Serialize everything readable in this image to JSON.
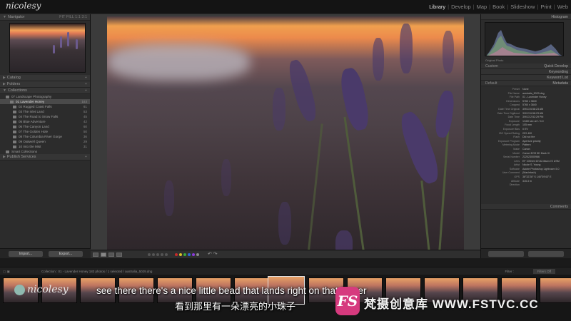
{
  "app": {
    "logo": "nicolesy",
    "modules": [
      "Library",
      "Develop",
      "Map",
      "Book",
      "Slideshow",
      "Print",
      "Web"
    ],
    "active_module": "Library"
  },
  "left_panel": {
    "navigator": {
      "label": "Navigator",
      "zoom_options": "FIT FILL 1:1 3:1"
    },
    "sections": [
      {
        "label": "Catalog"
      },
      {
        "label": "Folders"
      },
      {
        "label": "Collections"
      }
    ],
    "collections": [
      {
        "label": "07 Landscape Photography",
        "count": "",
        "level": 1
      },
      {
        "label": "01 Lavender Honey",
        "count": "183",
        "level": 2,
        "selected": true
      },
      {
        "label": "02 Rugged Coast Falls",
        "count": "61",
        "level": 2
      },
      {
        "label": "03 The Inlet Land",
        "count": "53",
        "level": 2
      },
      {
        "label": "04 The Road to Snow Falls",
        "count": "45",
        "level": 2
      },
      {
        "label": "05 Blue Adventure",
        "count": "42",
        "level": 2
      },
      {
        "label": "06 The Canyon Land",
        "count": "60",
        "level": 2
      },
      {
        "label": "07 The Golden Hole",
        "count": "50",
        "level": 2
      },
      {
        "label": "08 The Columbia River Gorge",
        "count": "36",
        "level": 2
      },
      {
        "label": "09 Oakwell Queen",
        "count": "29",
        "level": 2
      },
      {
        "label": "10 Into the Mist",
        "count": "31",
        "level": 2
      },
      {
        "label": "Smart Collections",
        "count": "",
        "level": 1
      }
    ],
    "publish_services": "Publish Services",
    "import_button": "Import...",
    "export_button": "Export..."
  },
  "right_panel": {
    "histogram": "Histogram",
    "original_photo": "Original Photo",
    "quick_develop": "Quick Develop",
    "quick_develop_preset": "Custom",
    "keywording": "Keywording",
    "keyword_list": "Keyword List",
    "metadata": "Metadata",
    "preset_label": "Preset",
    "preset_value": "None",
    "default_label": "Default",
    "metadata_rows": [
      {
        "key": "File Name",
        "value": "australia_5029.dng"
      },
      {
        "key": "File Path",
        "value": "01 - Lavender Honey"
      },
      {
        "key": "Dimensions",
        "value": "5760 x 3840"
      },
      {
        "key": "Cropped",
        "value": "5760 x 3840"
      },
      {
        "key": "Date Time Original",
        "value": "3/9/13 6:58:23 AM"
      },
      {
        "key": "Date Time Digitized",
        "value": "3/9/13 6:58:23 AM"
      },
      {
        "key": "Date Time",
        "value": "3/9/13 2:52:29 PM"
      },
      {
        "key": "Exposure",
        "value": "1/160 sec at f / 4.0"
      },
      {
        "key": "Focal Length",
        "value": "105 mm"
      },
      {
        "key": "Exposure Bias",
        "value": "0 EV"
      },
      {
        "key": "ISO Speed Rating",
        "value": "ISO 400"
      },
      {
        "key": "Flash",
        "value": "Did not fire"
      },
      {
        "key": "Exposure Program",
        "value": "Aperture priority"
      },
      {
        "key": "Metering Mode",
        "value": "Pattern"
      },
      {
        "key": "Make",
        "value": "Canon"
      },
      {
        "key": "Model",
        "value": "Canon EOS 5D Mark III"
      },
      {
        "key": "Serial Number",
        "value": "222023000966"
      },
      {
        "key": "Lens",
        "value": "EF 100mm f/2.8L Macro IS USM"
      },
      {
        "key": "Artist",
        "value": "Nicole S. Young"
      },
      {
        "key": "Software",
        "value": "Adobe Photoshop Lightroom 5.0 (Macintosh)"
      },
      {
        "key": "User Comment",
        "value": ""
      },
      {
        "key": "GPS",
        "value": "38°32'28\" S 145°39'43\" E"
      },
      {
        "key": "Altitude",
        "value": "315.3 m"
      },
      {
        "key": "Direction",
        "value": ""
      }
    ],
    "comments": "Comments"
  },
  "toolbar": {
    "sort_label": "",
    "swatch_colors": [
      "#c62a2a",
      "#d8c32a",
      "#3aa83a",
      "#2a6ad8",
      "#8a3ad8",
      "#8a8a8a"
    ]
  },
  "filmstrip_bar": {
    "path": "Collection : 01 - Lavender Honey     183 photos / 1 selected / australia_5029.dng",
    "filter_label": "Filter :",
    "filter_value": "Filters Off"
  },
  "overlay": {
    "watermark": "nicolesy",
    "subtitle_en": "see there there's a nice little bead that lands right on that flower",
    "subtitle_zh": "看到那里有一朵漂亮的小珠子",
    "brand_mark": "FS",
    "brand_name": "梵摄创意库 WWW.FSTVC.CC"
  }
}
